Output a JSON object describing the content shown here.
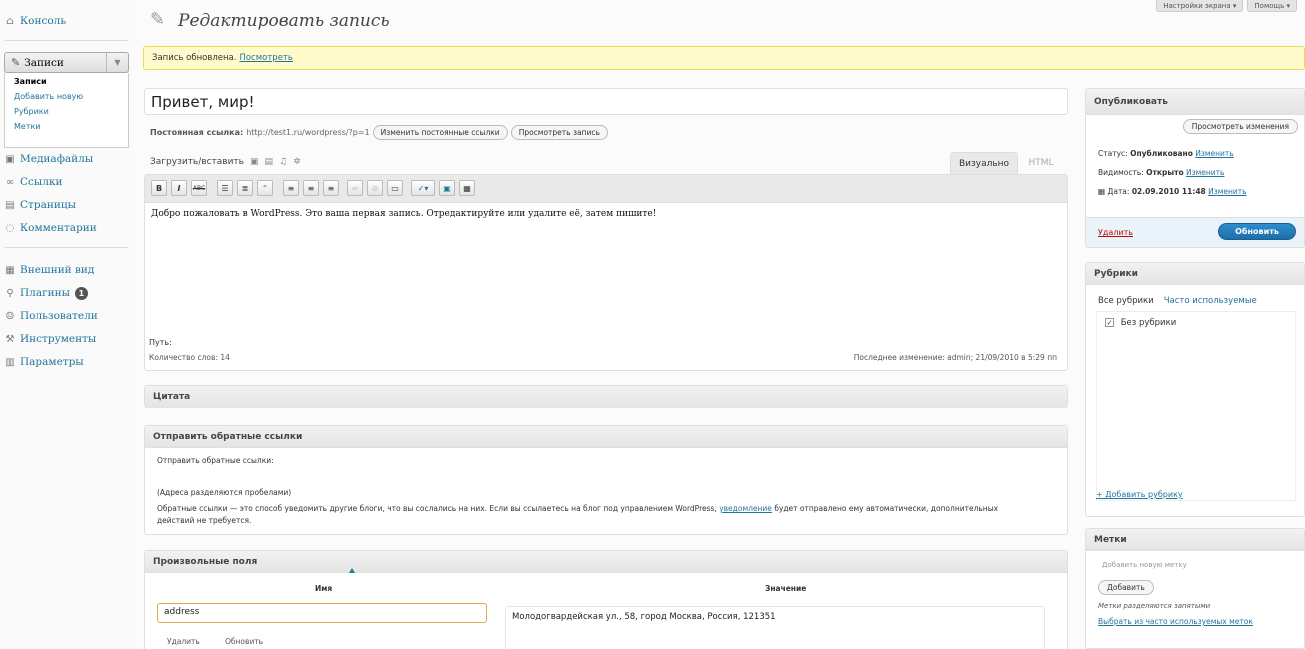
{
  "sidebar": {
    "items": [
      {
        "label": "Консоль",
        "icon": "house-icon"
      },
      {
        "label": "Записи",
        "icon": "pin-icon"
      },
      {
        "label": "Медиафайлы",
        "icon": "media-icon"
      },
      {
        "label": "Ссылки",
        "icon": "link-icon"
      },
      {
        "label": "Страницы",
        "icon": "page-icon"
      },
      {
        "label": "Комментарии",
        "icon": "comment-icon"
      },
      {
        "label": "Внешний вид",
        "icon": "appearance-icon"
      },
      {
        "label": "Плагины",
        "icon": "plugin-icon",
        "badge": "1"
      },
      {
        "label": "Пользователи",
        "icon": "users-icon"
      },
      {
        "label": "Инструменты",
        "icon": "tools-icon"
      },
      {
        "label": "Параметры",
        "icon": "settings-icon"
      }
    ],
    "submenu": [
      "Записи",
      "Добавить новую",
      "Рубрики",
      "Метки"
    ]
  },
  "top": {
    "screen_options": "Настройки экрана ▾",
    "help": "Помощь ▾"
  },
  "header": {
    "title": "Редактировать запись"
  },
  "notice": {
    "text": "Запись обновлена.",
    "link": "Посмотреть"
  },
  "post": {
    "title": "Привет, мир!",
    "permalink_label": "Постоянная ссылка:",
    "permalink_url": "http://test1.ru/wordpress/?p=1",
    "change_permalink": "Изменить постоянные ссылки",
    "view_post": "Просмотреть запись",
    "upload_label": "Загрузить/вставить",
    "tab_visual": "Визуально",
    "tab_html": "HTML",
    "content": "Добро пожаловать в WordPress. Это ваша первая запись. Отредактируйте или удалите её, затем пишите!",
    "path": "Путь:",
    "word_count": "Количество слов: 14",
    "last_edit": "Последнее изменение: admin; 21/09/2010 в 5:29 пп"
  },
  "boxes": {
    "citata": "Цитата",
    "trackbacks_title": "Отправить обратные ссылки",
    "trackbacks_label": "Отправить обратные ссылки:",
    "trackbacks_hint": "(Адреса разделяются пробелами)",
    "trackbacks_note_pre": "Обратные ссылки — это способ уведомить другие блоги, что вы сослались на них. Если вы ссылаетесь на блог под управлением WordPress,",
    "trackbacks_note_link": "уведомление",
    "trackbacks_note_post": "будет отправлено ему автоматически, дополнительных действий не требуется.",
    "custom_fields_title": "Произвольные поля",
    "cf_name_header": "Имя",
    "cf_value_header": "Значение",
    "cf_name": "address",
    "cf_value": "Молодогвардейская ул., 58, город Москва, Россия, 121351",
    "cf_delete": "Удалить",
    "cf_update": "Обновить"
  },
  "publish": {
    "title": "Опубликовать",
    "preview": "Просмотреть изменения",
    "status_label": "Статус:",
    "status_value": "Опубликовано",
    "visibility_label": "Видимость:",
    "visibility_value": "Открыто",
    "date_label": "Дата:",
    "date_value": "02.09.2010 11:48",
    "change": "Изменить",
    "delete": "Удалить",
    "update": "Обновить"
  },
  "categories": {
    "title": "Рубрики",
    "tab_all": "Все рубрики",
    "tab_popular": "Часто используемые",
    "item": "Без рубрики",
    "add": "+ Добавить рубрику"
  },
  "tags": {
    "title": "Метки",
    "placeholder": "Добавить новую метку",
    "add": "Добавить",
    "note": "Метки разделяются запятыми",
    "choose": "Выбрать из часто используемых меток"
  }
}
